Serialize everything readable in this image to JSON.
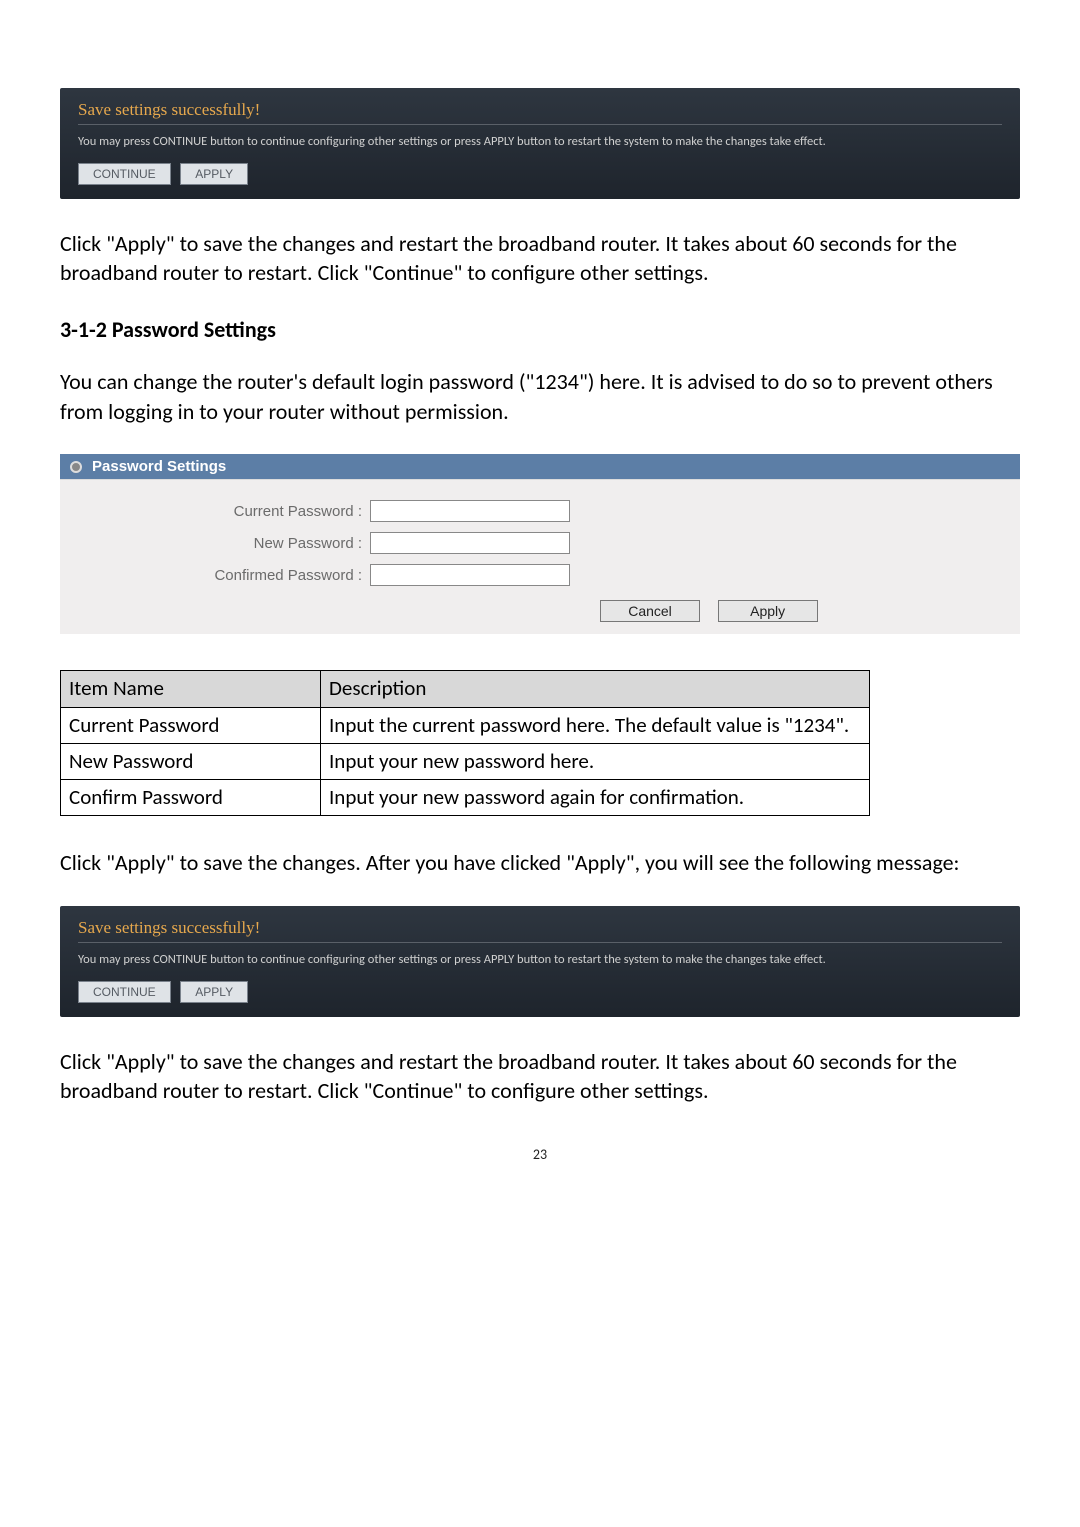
{
  "save_panel_1": {
    "title": "Save settings successfully!",
    "description": "You may press CONTINUE button to continue configuring other settings or press APPLY button to restart the system to make the changes take effect.",
    "continue_label": "CONTINUE",
    "apply_label": "APPLY"
  },
  "paragraph_1": "Click \"Apply\" to save the changes and restart the broadband router. It takes about 60 seconds for the broadband router to restart. Click \"Continue\" to configure other settings.",
  "heading_1": "3-1-2 Password Settings",
  "paragraph_2": "You can change the router's default login password (\"1234\") here. It is advised to do so to prevent others from logging in to your router without permission.",
  "password_panel": {
    "header": "Password Settings",
    "labels": {
      "current": "Current Password :",
      "new": "New Password :",
      "confirm": "Confirmed Password :"
    },
    "buttons": {
      "cancel": "Cancel",
      "apply": "Apply"
    }
  },
  "desc_table": {
    "headers": {
      "col1": "Item Name",
      "col2": "Description"
    },
    "rows": [
      {
        "name": "Current Password",
        "desc": "Input the current password here. The default value is \"1234\"."
      },
      {
        "name": "New Password",
        "desc": "Input your new password here."
      },
      {
        "name": "Confirm Password",
        "desc": "Input your new password again for confirmation."
      }
    ]
  },
  "paragraph_3": "Click \"Apply\" to save the changes. After you have clicked \"Apply\", you will see the following message:",
  "save_panel_2": {
    "title": "Save settings successfully!",
    "description": "You may press CONTINUE button to continue configuring other settings or press APPLY button to restart the system to make the changes take effect.",
    "continue_label": "CONTINUE",
    "apply_label": "APPLY"
  },
  "paragraph_4": "Click \"Apply\" to save the changes and restart the broadband router. It takes about 60 seconds for the broadband router to restart. Click \"Continue\" to configure other settings.",
  "page_number": "23"
}
